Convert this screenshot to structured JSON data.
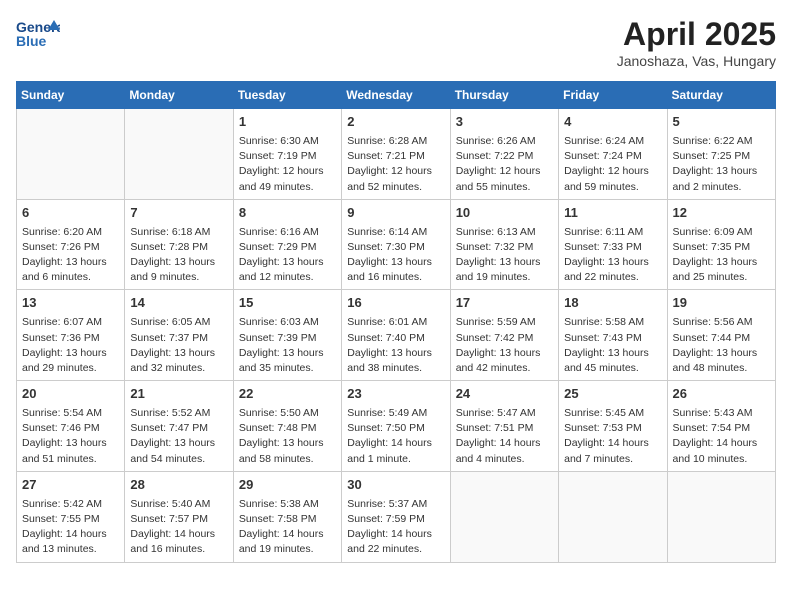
{
  "header": {
    "logo_text_general": "General",
    "logo_text_blue": "Blue",
    "month_title": "April 2025",
    "subtitle": "Janoshaza, Vas, Hungary"
  },
  "days_of_week": [
    "Sunday",
    "Monday",
    "Tuesday",
    "Wednesday",
    "Thursday",
    "Friday",
    "Saturday"
  ],
  "weeks": [
    [
      {
        "day": "",
        "info": ""
      },
      {
        "day": "",
        "info": ""
      },
      {
        "day": "1",
        "info": "Sunrise: 6:30 AM\nSunset: 7:19 PM\nDaylight: 12 hours and 49 minutes."
      },
      {
        "day": "2",
        "info": "Sunrise: 6:28 AM\nSunset: 7:21 PM\nDaylight: 12 hours and 52 minutes."
      },
      {
        "day": "3",
        "info": "Sunrise: 6:26 AM\nSunset: 7:22 PM\nDaylight: 12 hours and 55 minutes."
      },
      {
        "day": "4",
        "info": "Sunrise: 6:24 AM\nSunset: 7:24 PM\nDaylight: 12 hours and 59 minutes."
      },
      {
        "day": "5",
        "info": "Sunrise: 6:22 AM\nSunset: 7:25 PM\nDaylight: 13 hours and 2 minutes."
      }
    ],
    [
      {
        "day": "6",
        "info": "Sunrise: 6:20 AM\nSunset: 7:26 PM\nDaylight: 13 hours and 6 minutes."
      },
      {
        "day": "7",
        "info": "Sunrise: 6:18 AM\nSunset: 7:28 PM\nDaylight: 13 hours and 9 minutes."
      },
      {
        "day": "8",
        "info": "Sunrise: 6:16 AM\nSunset: 7:29 PM\nDaylight: 13 hours and 12 minutes."
      },
      {
        "day": "9",
        "info": "Sunrise: 6:14 AM\nSunset: 7:30 PM\nDaylight: 13 hours and 16 minutes."
      },
      {
        "day": "10",
        "info": "Sunrise: 6:13 AM\nSunset: 7:32 PM\nDaylight: 13 hours and 19 minutes."
      },
      {
        "day": "11",
        "info": "Sunrise: 6:11 AM\nSunset: 7:33 PM\nDaylight: 13 hours and 22 minutes."
      },
      {
        "day": "12",
        "info": "Sunrise: 6:09 AM\nSunset: 7:35 PM\nDaylight: 13 hours and 25 minutes."
      }
    ],
    [
      {
        "day": "13",
        "info": "Sunrise: 6:07 AM\nSunset: 7:36 PM\nDaylight: 13 hours and 29 minutes."
      },
      {
        "day": "14",
        "info": "Sunrise: 6:05 AM\nSunset: 7:37 PM\nDaylight: 13 hours and 32 minutes."
      },
      {
        "day": "15",
        "info": "Sunrise: 6:03 AM\nSunset: 7:39 PM\nDaylight: 13 hours and 35 minutes."
      },
      {
        "day": "16",
        "info": "Sunrise: 6:01 AM\nSunset: 7:40 PM\nDaylight: 13 hours and 38 minutes."
      },
      {
        "day": "17",
        "info": "Sunrise: 5:59 AM\nSunset: 7:42 PM\nDaylight: 13 hours and 42 minutes."
      },
      {
        "day": "18",
        "info": "Sunrise: 5:58 AM\nSunset: 7:43 PM\nDaylight: 13 hours and 45 minutes."
      },
      {
        "day": "19",
        "info": "Sunrise: 5:56 AM\nSunset: 7:44 PM\nDaylight: 13 hours and 48 minutes."
      }
    ],
    [
      {
        "day": "20",
        "info": "Sunrise: 5:54 AM\nSunset: 7:46 PM\nDaylight: 13 hours and 51 minutes."
      },
      {
        "day": "21",
        "info": "Sunrise: 5:52 AM\nSunset: 7:47 PM\nDaylight: 13 hours and 54 minutes."
      },
      {
        "day": "22",
        "info": "Sunrise: 5:50 AM\nSunset: 7:48 PM\nDaylight: 13 hours and 58 minutes."
      },
      {
        "day": "23",
        "info": "Sunrise: 5:49 AM\nSunset: 7:50 PM\nDaylight: 14 hours and 1 minute."
      },
      {
        "day": "24",
        "info": "Sunrise: 5:47 AM\nSunset: 7:51 PM\nDaylight: 14 hours and 4 minutes."
      },
      {
        "day": "25",
        "info": "Sunrise: 5:45 AM\nSunset: 7:53 PM\nDaylight: 14 hours and 7 minutes."
      },
      {
        "day": "26",
        "info": "Sunrise: 5:43 AM\nSunset: 7:54 PM\nDaylight: 14 hours and 10 minutes."
      }
    ],
    [
      {
        "day": "27",
        "info": "Sunrise: 5:42 AM\nSunset: 7:55 PM\nDaylight: 14 hours and 13 minutes."
      },
      {
        "day": "28",
        "info": "Sunrise: 5:40 AM\nSunset: 7:57 PM\nDaylight: 14 hours and 16 minutes."
      },
      {
        "day": "29",
        "info": "Sunrise: 5:38 AM\nSunset: 7:58 PM\nDaylight: 14 hours and 19 minutes."
      },
      {
        "day": "30",
        "info": "Sunrise: 5:37 AM\nSunset: 7:59 PM\nDaylight: 14 hours and 22 minutes."
      },
      {
        "day": "",
        "info": ""
      },
      {
        "day": "",
        "info": ""
      },
      {
        "day": "",
        "info": ""
      }
    ]
  ]
}
